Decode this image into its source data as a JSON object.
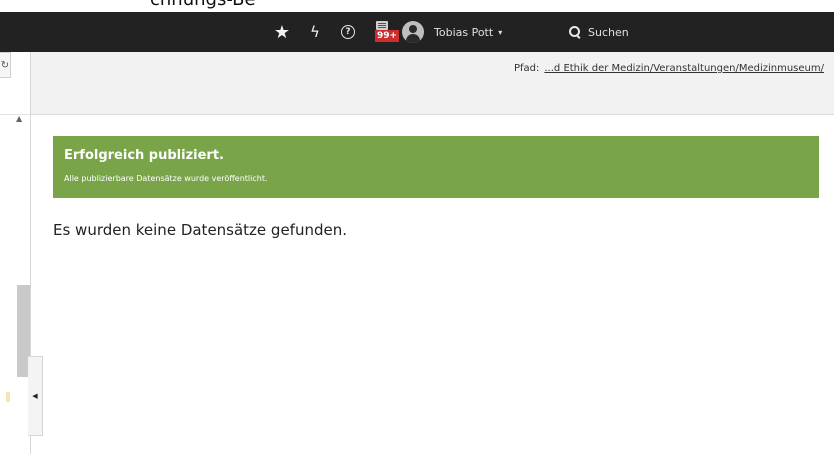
{
  "top_caption": "chnungs-Be",
  "toolbar": {
    "bookmarks_icon": "star-icon",
    "clear_cache_icon": "bolt-icon",
    "help_icon": "help-circle-icon",
    "help_glyph": "?",
    "notifications_badge": "99+",
    "user_name": "Tobias Pott",
    "search_label": "Suchen"
  },
  "pathbar": {
    "label": "Pfad:",
    "value": "...d Ethik der Medizin/Veranstaltungen/Medizinmuseum/"
  },
  "alert": {
    "title": "Erfolgreich publiziert.",
    "message": "Alle publizierbare Datensätze wurde veröffentlicht.",
    "color": "#79a548"
  },
  "main": {
    "empty_message": "Es wurden keine Datensätze gefunden."
  }
}
